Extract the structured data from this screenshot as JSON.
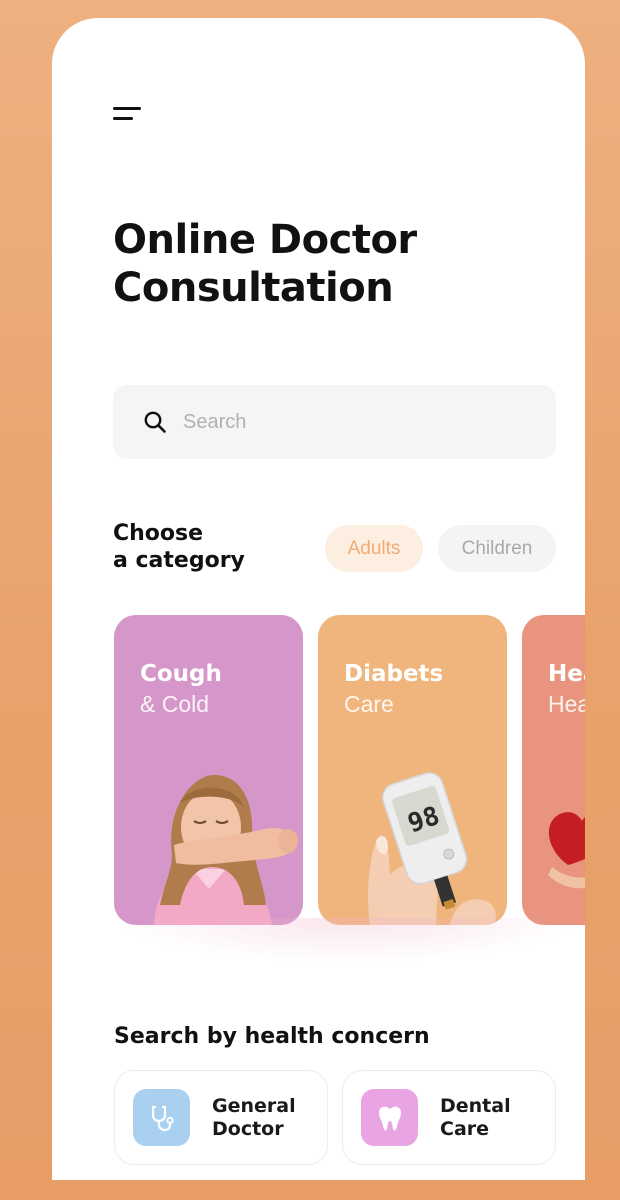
{
  "header": {
    "menu_icon": "hamburger-menu-icon",
    "title_line1": "Online Doctor",
    "title_line2": "Consultation"
  },
  "search": {
    "icon": "search-icon",
    "placeholder": "Search",
    "value": ""
  },
  "categories": {
    "heading_line1": "Choose",
    "heading_line2": "a category",
    "filters": [
      {
        "label": "Adults",
        "selected": true
      },
      {
        "label": "Children",
        "selected": false
      }
    ],
    "cards": [
      {
        "title": "Cough",
        "subtitle": "& Cold",
        "color": "#d597c9"
      },
      {
        "title": "Diabets",
        "subtitle": "Care",
        "color": "#f0b57d"
      },
      {
        "title": "Heart",
        "subtitle": "Health",
        "color": "#e8947e"
      }
    ]
  },
  "concerns": {
    "heading": "Search by health concern",
    "items": [
      {
        "line1": "General",
        "line2": "Doctor",
        "icon": "stethoscope-icon",
        "color": "#a9d0f1"
      },
      {
        "line1": "Dental",
        "line2": "Care",
        "icon": "tooth-icon",
        "color": "#e8a4e3"
      }
    ]
  },
  "colors": {
    "accent": "#f2ab72",
    "background": "#eeb080"
  }
}
